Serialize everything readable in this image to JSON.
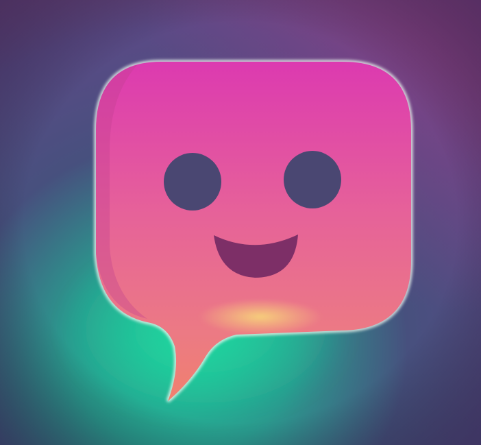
{
  "image": {
    "subject": "smiling-speech-bubble-icon",
    "colors": {
      "background_dark": "#3e3566",
      "background_mid": "#5b4a86",
      "background_magenta": "#8a3f86",
      "glow_teal": "#1fc99a",
      "glow_teal_soft": "#2a9a8e",
      "bubble_top": "#dc3ab0",
      "bubble_mid": "#e8688f",
      "bubble_bottom": "#f0806e",
      "highlight_yellow": "#f7d77a",
      "rim_light": "#eef8f0",
      "eye_color": "#4a4772",
      "mouth_color": "#7d2f67"
    }
  }
}
